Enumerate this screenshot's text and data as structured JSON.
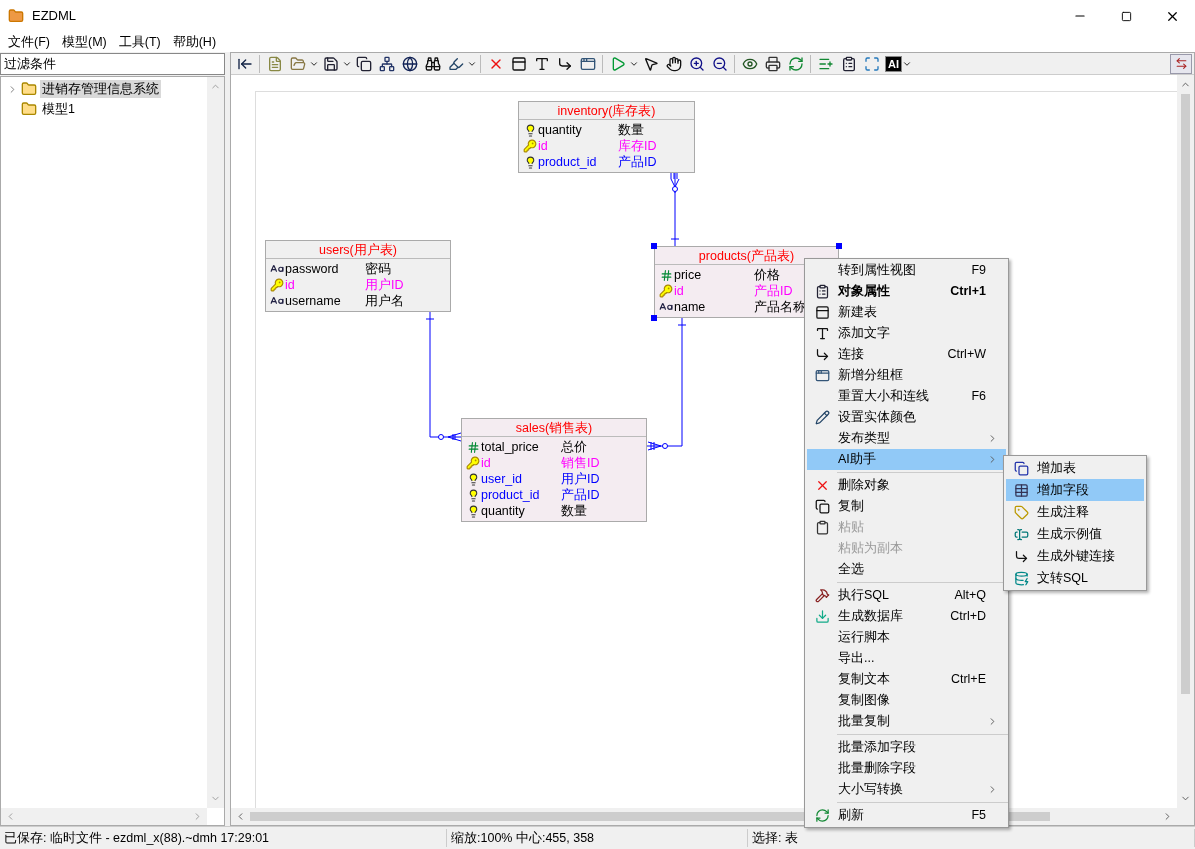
{
  "window": {
    "title": "EZDML"
  },
  "menu_bar": [
    "文件(F)",
    "模型(M)",
    "工具(T)",
    "帮助(H)"
  ],
  "filter": {
    "placeholder": "过滤条件"
  },
  "tree": [
    {
      "label": "进销存管理信息系统",
      "selected": true,
      "expanded": false
    },
    {
      "label": "模型1",
      "selected": false
    }
  ],
  "toolbar": {
    "ai_button": "AI"
  },
  "tables": [
    {
      "title": "inventory(库存表)",
      "selected": false,
      "color": "#f0f0f0",
      "fields": [
        {
          "name": "quantity",
          "comment": "数量",
          "kind": "index",
          "color": "#000000"
        },
        {
          "name": "id",
          "comment": "库存ID",
          "kind": "key",
          "color": "#ff00ff"
        },
        {
          "name": "product_id",
          "comment": "产品ID",
          "kind": "index",
          "color": "#0000ff"
        }
      ]
    },
    {
      "title": "users(用户表)",
      "selected": false,
      "color": "#f0f0f0",
      "fields": [
        {
          "name": "password",
          "comment": "密码",
          "kind": "text",
          "color": "#000000"
        },
        {
          "name": "id",
          "comment": "用户ID",
          "kind": "key",
          "color": "#ff00ff"
        },
        {
          "name": "username",
          "comment": "用户名",
          "kind": "text",
          "color": "#000000"
        }
      ]
    },
    {
      "title": "products(产品表)",
      "selected": true,
      "color": "#f4ecf1",
      "fields": [
        {
          "name": "price",
          "comment": "价格",
          "kind": "number",
          "color": "#000000"
        },
        {
          "name": "id",
          "comment": "产品ID",
          "kind": "key",
          "color": "#ff00ff"
        },
        {
          "name": "name",
          "comment": "产品名称",
          "kind": "text",
          "color": "#000000"
        }
      ]
    },
    {
      "title": "sales(销售表)",
      "selected": false,
      "color": "#f4ecf1",
      "fields": [
        {
          "name": "total_price",
          "comment": "总价",
          "kind": "number",
          "color": "#000000"
        },
        {
          "name": "id",
          "comment": "销售ID",
          "kind": "key",
          "color": "#ff00ff"
        },
        {
          "name": "user_id",
          "comment": "用户ID",
          "kind": "index",
          "color": "#0000ff"
        },
        {
          "name": "product_id",
          "comment": "产品ID",
          "kind": "index",
          "color": "#0000ff"
        },
        {
          "name": "quantity",
          "comment": "数量",
          "kind": "index",
          "color": "#000000"
        }
      ]
    }
  ],
  "context_menu": [
    {
      "kind": "item",
      "label": "转到属性视图",
      "shortcut": "F9",
      "bold": false,
      "disabled": false,
      "submenu": false,
      "selected": false
    },
    {
      "kind": "item",
      "label": "对象属性",
      "shortcut": "Ctrl+1",
      "bold": true,
      "disabled": false,
      "submenu": false,
      "selected": false
    },
    {
      "kind": "item",
      "label": "新建表",
      "bold": false,
      "disabled": false,
      "submenu": false,
      "selected": false
    },
    {
      "kind": "item",
      "label": "添加文字",
      "bold": false,
      "disabled": false,
      "submenu": false,
      "selected": false
    },
    {
      "kind": "item",
      "label": "连接",
      "shortcut": "Ctrl+W",
      "bold": false,
      "disabled": false,
      "submenu": false,
      "selected": false
    },
    {
      "kind": "item",
      "label": "新增分组框",
      "bold": false,
      "disabled": false,
      "submenu": false,
      "selected": false
    },
    {
      "kind": "item",
      "label": "重置大小和连线",
      "shortcut": "F6",
      "bold": false,
      "disabled": false,
      "submenu": false,
      "selected": false
    },
    {
      "kind": "item",
      "label": "设置实体颜色",
      "bold": false,
      "disabled": false,
      "submenu": false,
      "selected": false
    },
    {
      "kind": "item",
      "label": "发布类型",
      "bold": false,
      "disabled": false,
      "submenu": true,
      "selected": false
    },
    {
      "kind": "item",
      "label": "AI助手",
      "bold": false,
      "disabled": false,
      "submenu": true,
      "selected": true
    },
    {
      "kind": "separator"
    },
    {
      "kind": "item",
      "label": "删除对象",
      "bold": false,
      "disabled": false,
      "submenu": false,
      "selected": false
    },
    {
      "kind": "item",
      "label": "复制",
      "bold": false,
      "disabled": false,
      "submenu": false,
      "selected": false
    },
    {
      "kind": "item",
      "label": "粘贴",
      "bold": false,
      "disabled": true,
      "submenu": false,
      "selected": false
    },
    {
      "kind": "item",
      "label": "粘贴为副本",
      "bold": false,
      "disabled": true,
      "submenu": false,
      "selected": false
    },
    {
      "kind": "item",
      "label": "全选",
      "bold": false,
      "disabled": false,
      "submenu": false,
      "selected": false
    },
    {
      "kind": "separator"
    },
    {
      "kind": "item",
      "label": "执行SQL",
      "shortcut": "Alt+Q",
      "bold": false,
      "disabled": false,
      "submenu": false,
      "selected": false
    },
    {
      "kind": "item",
      "label": "生成数据库",
      "shortcut": "Ctrl+D",
      "bold": false,
      "disabled": false,
      "submenu": false,
      "selected": false
    },
    {
      "kind": "item",
      "label": "运行脚本",
      "bold": false,
      "disabled": false,
      "submenu": false,
      "selected": false
    },
    {
      "kind": "item",
      "label": "导出...",
      "bold": false,
      "disabled": false,
      "submenu": false,
      "selected": false
    },
    {
      "kind": "item",
      "label": "复制文本",
      "shortcut": "Ctrl+E",
      "bold": false,
      "disabled": false,
      "submenu": false,
      "selected": false
    },
    {
      "kind": "item",
      "label": "复制图像",
      "bold": false,
      "disabled": false,
      "submenu": false,
      "selected": false
    },
    {
      "kind": "item",
      "label": "批量复制",
      "bold": false,
      "disabled": false,
      "submenu": true,
      "selected": false
    },
    {
      "kind": "separator"
    },
    {
      "kind": "item",
      "label": "批量添加字段",
      "bold": false,
      "disabled": false,
      "submenu": false,
      "selected": false
    },
    {
      "kind": "item",
      "label": "批量删除字段",
      "bold": false,
      "disabled": false,
      "submenu": false,
      "selected": false
    },
    {
      "kind": "item",
      "label": "大小写转换",
      "bold": false,
      "disabled": false,
      "submenu": true,
      "selected": false
    },
    {
      "kind": "separator"
    },
    {
      "kind": "item",
      "label": "刷新",
      "shortcut": "F5",
      "bold": false,
      "disabled": false,
      "submenu": false,
      "selected": false
    }
  ],
  "submenu": [
    {
      "label": "增加表",
      "selected": false
    },
    {
      "label": "增加字段",
      "selected": true
    },
    {
      "label": "生成注释",
      "selected": false
    },
    {
      "label": "生成示例值",
      "selected": false
    },
    {
      "label": "生成外键连接",
      "selected": false
    },
    {
      "label": "文转SQL",
      "selected": false
    }
  ],
  "status_bar": [
    "已保存: 临时文件 - ezdml_x(88).~dmh 17:29:01",
    "缩放:100% 中心:455, 358",
    "选择: 表"
  ]
}
